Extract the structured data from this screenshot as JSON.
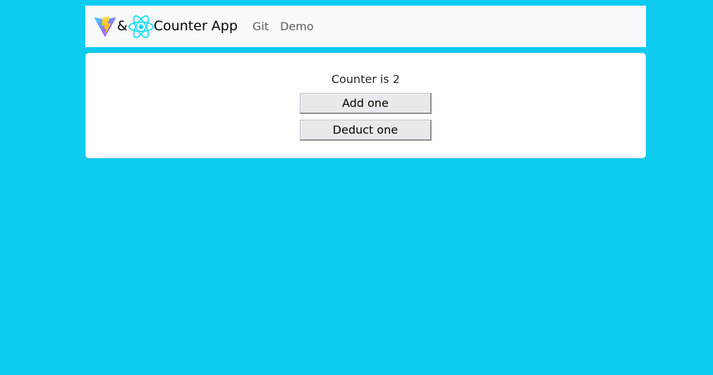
{
  "navbar": {
    "brand": {
      "vite_icon": "vite-logo-icon",
      "ampersand": "&",
      "react_icon": "react-logo-icon",
      "title": "Counter App"
    },
    "links": [
      {
        "label": "Git"
      },
      {
        "label": "Demo"
      }
    ]
  },
  "counter": {
    "text": "Counter is 2",
    "value": 2
  },
  "buttons": {
    "add_label": "Add one",
    "deduct_label": "Deduct one"
  },
  "colors": {
    "background": "#0ecbf0",
    "navbar": "#f8f9fa",
    "card": "#ffffff",
    "react": "#00d8ff",
    "vite_purple": "#a855f7",
    "vite_yellow": "#ffc517"
  }
}
